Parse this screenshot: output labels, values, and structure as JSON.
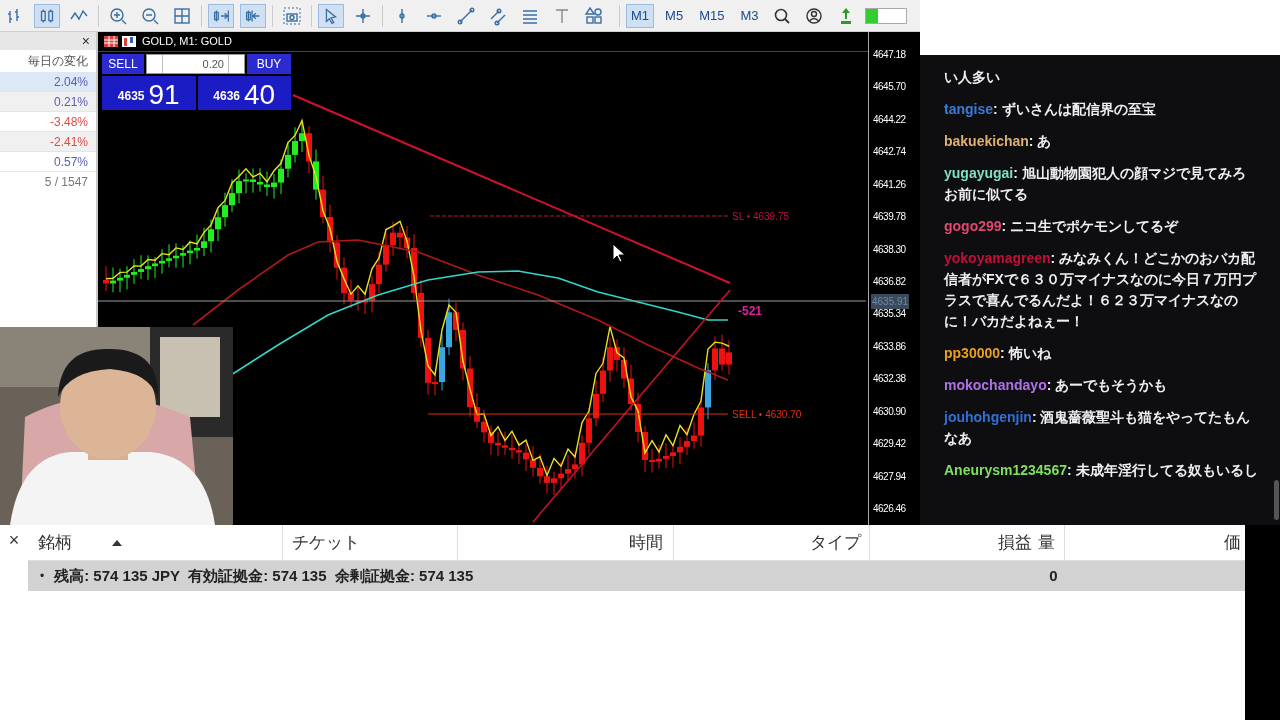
{
  "toolbar": {
    "timeframes": [
      {
        "label": "M1",
        "selected": true
      },
      {
        "label": "M5",
        "selected": false
      },
      {
        "label": "M15",
        "selected": false
      },
      {
        "label": "M3",
        "selected": false
      }
    ]
  },
  "market_watch": {
    "close_label": "×",
    "column": "毎日の変化",
    "rows": [
      {
        "change": "2.04%",
        "color": "#5a5ab8",
        "selected": true
      },
      {
        "change": "0.21%",
        "color": "#5a5ab8",
        "selected": false
      },
      {
        "change": "-3.48%",
        "color": "#e04848",
        "selected": false
      },
      {
        "change": "-2.41%",
        "color": "#e04848",
        "selected": false
      },
      {
        "change": "0.57%",
        "color": "#5a5ab8",
        "selected": false
      }
    ],
    "footer": "5 / 1547"
  },
  "chart": {
    "title": "GOLD, M1: GOLD",
    "one_click": {
      "sell_label": "SELL",
      "buy_label": "BUY",
      "lot": "0.20",
      "sell_small": "4635",
      "sell_big": "91",
      "buy_small": "4636",
      "buy_big": "40"
    },
    "price_axis": [
      "4647.18",
      "4645.70",
      "4644.22",
      "4642.74",
      "4641.26",
      "4639.78",
      "4638.30",
      "4636.82",
      "4635.34",
      "4633.86",
      "4632.38",
      "4630.90",
      "4629.42",
      "4627.94",
      "4626.46"
    ],
    "current_price": "4635.91",
    "sl_label": "SL • 4639.75",
    "order_label": "SELL • 4630.70",
    "profit_label": "-521"
  },
  "chat": {
    "separator": ":",
    "messages": [
      {
        "text": "い人多い"
      },
      {
        "user": "tangise",
        "color": "#3b7bd8",
        "text": "ずいさんは配信界の至宝"
      },
      {
        "user": "bakuekichan",
        "color": "#e0b070",
        "text": "あ"
      },
      {
        "user": "yugayugai",
        "color": "#7fe0c0",
        "text": "旭山動物園犯人の顔マジで見てみろお前に似てる"
      },
      {
        "user": "gogo299",
        "color": "#e04870",
        "text": "ニコ生でポケモンしてるぞ"
      },
      {
        "user": "yokoyamagreen",
        "color": "#c0103a",
        "text": "みなみくん！どこかのおバカ配信者がFXで６３０万マイナスなのに今日７万円プラスで喜んでるんだよ！６２３万マイナスなのに！バカだよねぇー！"
      },
      {
        "user": "pp30000",
        "color": "#e8a020",
        "text": "怖いね"
      },
      {
        "user": "mokochandayo",
        "color": "#b070e8",
        "text": "あーでもそうかも"
      },
      {
        "user": "jouhohgenjin",
        "color": "#3070d8",
        "text": "酒鬼薔薇聖斗も猫をやってたもんなあ"
      },
      {
        "user": "Aneurysm1234567",
        "color": "#80e060",
        "text": "未成年淫行してる奴もいるし"
      }
    ]
  },
  "trade_panel": {
    "close_label": "×",
    "columns": [
      {
        "label": "銘柄",
        "sorted": true
      },
      {
        "label": "チケット",
        "sorted": false
      },
      {
        "label": "時間",
        "sorted": false
      },
      {
        "label": "タイプ",
        "sorted": false
      },
      {
        "label": "損益",
        "sorted": false
      },
      {
        "label": "量",
        "sorted": false
      },
      {
        "label": "価",
        "sorted": false
      }
    ],
    "balance_row": {
      "marker": "•",
      "text": "残高: 574 135 JPY  有効証拠金: 574 135  余剰証拠金: 574 135",
      "profit": "0"
    }
  }
}
